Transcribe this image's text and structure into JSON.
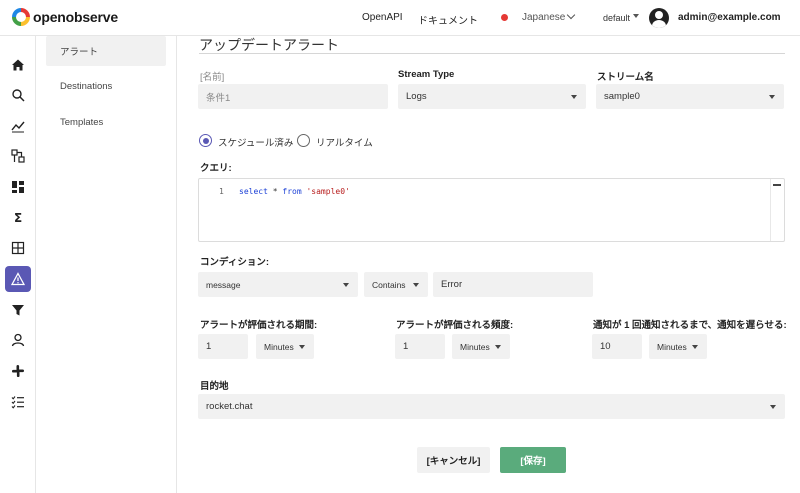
{
  "app": {
    "logo_text": "openobserve"
  },
  "header": {
    "nav": {
      "openapi": "OpenAPI",
      "docs": "ドキュメント"
    },
    "language": "Japanese",
    "org": "default",
    "user_email": "admin@example.com"
  },
  "rail": {
    "items": [
      "home-icon",
      "search-icon",
      "metrics-icon",
      "traces-icon",
      "dashboards-icon",
      "functions-icon",
      "streams-icon",
      "alerts-icon",
      "ingestion-filter-icon",
      "users-icon",
      "slack-icon",
      "reports-icon"
    ],
    "active": "alerts-icon",
    "accent": "#5a58b4"
  },
  "submenu": {
    "items": [
      {
        "label": "アラート",
        "active": true
      },
      {
        "label": "Destinations",
        "active": false
      },
      {
        "label": "Templates",
        "active": false
      }
    ]
  },
  "form": {
    "title": "アップデートアラート",
    "name_label": "[名前]",
    "name_value": "条件1",
    "stream_type_label": "Stream Type",
    "stream_type_value": "Logs",
    "stream_name_label": "ストリーム名",
    "stream_name_value": "sample0",
    "schedule_options": [
      {
        "label": "スケジュール済み",
        "checked": true
      },
      {
        "label": "リアルタイム",
        "checked": false
      }
    ],
    "query_label": "クエリ:",
    "query_line_number": "1",
    "query_tokens": {
      "kw1": "select",
      "op": "*",
      "kw2": "from",
      "str": "'sample0'"
    },
    "condition_label": "コンディション:",
    "condition_field": "message",
    "condition_operator": "Contains",
    "condition_value": "Error",
    "period_label": "アラートが評価される期間:",
    "period_value": "1",
    "period_unit": "Minutes",
    "frequency_label": "アラートが評価される頻度:",
    "frequency_value": "1",
    "frequency_unit": "Minutes",
    "silence_label": "通知が 1 回通知されるまで、通知を遅らせる:",
    "silence_value": "10",
    "silence_unit": "Minutes",
    "destination_label": "目的地",
    "destination_value": "rocket.chat",
    "cancel_label": "[キャンセル]",
    "save_label": "[保存]",
    "save_color": "#5aab7c"
  }
}
